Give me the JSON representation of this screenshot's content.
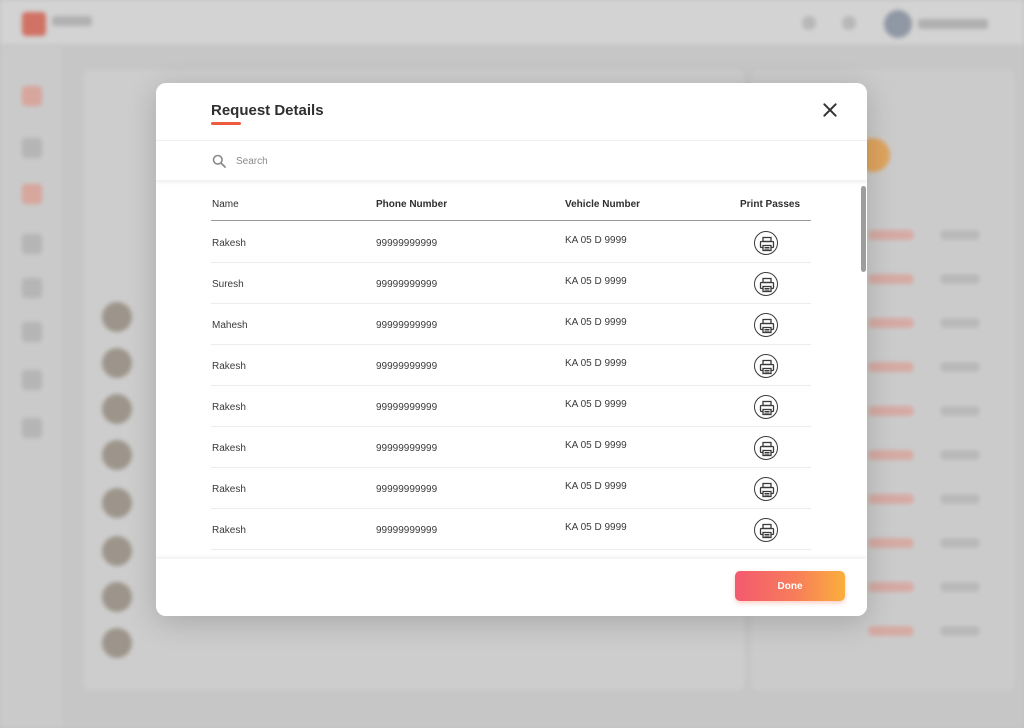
{
  "dialog": {
    "title": "Request Details",
    "search_placeholder": "Search",
    "done_label": "Done"
  },
  "table": {
    "headers": {
      "name": "Name",
      "phone": "Phone Number",
      "vehicle": "Vehicle Number",
      "print": "Print Passes"
    },
    "rows": [
      {
        "name": "Rakesh",
        "phone": "99999999999",
        "vehicle": "KA 05 D 9999"
      },
      {
        "name": "Suresh",
        "phone": "99999999999",
        "vehicle": "KA 05 D 9999"
      },
      {
        "name": "Mahesh",
        "phone": "99999999999",
        "vehicle": "KA 05 D 9999"
      },
      {
        "name": "Rakesh",
        "phone": "99999999999",
        "vehicle": "KA 05 D 9999"
      },
      {
        "name": "Rakesh",
        "phone": "99999999999",
        "vehicle": "KA 05 D 9999"
      },
      {
        "name": "Rakesh",
        "phone": "99999999999",
        "vehicle": "KA 05 D 9999"
      },
      {
        "name": "Rakesh",
        "phone": "99999999999",
        "vehicle": "KA 05 D 9999"
      },
      {
        "name": "Rakesh",
        "phone": "99999999999",
        "vehicle": "KA 05 D 9999"
      }
    ]
  },
  "icons": {
    "close": "close-icon",
    "search": "search-icon",
    "print": "printer-icon"
  },
  "colors": {
    "accent": "#ef5b3f",
    "done_gradient_start": "#f3596f",
    "done_gradient_end": "#fbae3c"
  }
}
